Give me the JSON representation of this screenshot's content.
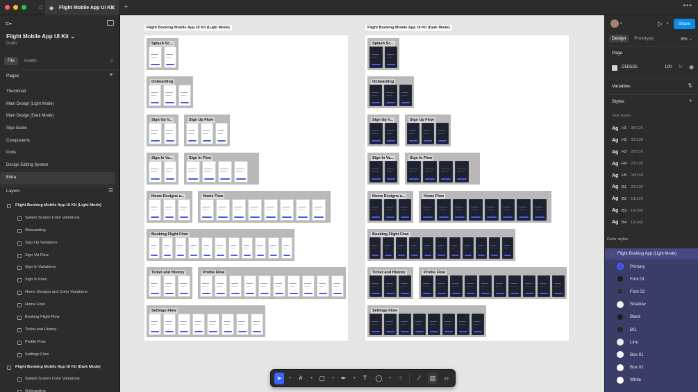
{
  "titlebar": {
    "traffic_colors": [
      "#ff5f57",
      "#febc2e",
      "#28c840"
    ],
    "tab_title": "Flight Mobile App UI Kit",
    "tab_close": "✕",
    "tab_plus": "+",
    "menu": "•••"
  },
  "left_panel": {
    "file_title": "Flight Mobile App UI Kit",
    "file_sub": "Drafts",
    "tabs": [
      "File",
      "Assets"
    ],
    "pages_header": "Pages",
    "pages": [
      "Thumbnail",
      "Main Design (Light Mode)",
      "Main Design (Dark Mode)",
      "Stye Guide",
      "Components",
      "Icons",
      "Design Editing System",
      "Extra"
    ],
    "selected_page_index": 7,
    "layers_header": "Layers",
    "layers": [
      {
        "name": "Flight Booking Mobile App UI Kit (Light Mode)",
        "level": 0
      },
      {
        "name": "Splash Screen Color Variations",
        "level": 1
      },
      {
        "name": "Onboarding",
        "level": 1
      },
      {
        "name": "Sign Up Variations",
        "level": 1
      },
      {
        "name": "Sign Up Flow",
        "level": 1
      },
      {
        "name": "Sign In Variations",
        "level": 1
      },
      {
        "name": "Sign In Flow",
        "level": 1
      },
      {
        "name": "Home Designs and Color Variations",
        "level": 1
      },
      {
        "name": "Home Flow",
        "level": 1
      },
      {
        "name": "Booking Flight Flow",
        "level": 1
      },
      {
        "name": "Ticket and History",
        "level": 1
      },
      {
        "name": "Profile Flow",
        "level": 1
      },
      {
        "name": "Settings Flow",
        "level": 1
      },
      {
        "name": "Flight Booking Mobile App UI Kit (Dark Mode)",
        "level": 0
      },
      {
        "name": "Splash Screen Color Variations",
        "level": 1
      },
      {
        "name": "Onboarding",
        "level": 1
      }
    ]
  },
  "canvas": {
    "frames": [
      {
        "label": "Flight Booking Mobile App UI Kit (Light Mode)",
        "mode": "light",
        "groups": [
          {
            "title": "Splash Sc...",
            "screens": 2
          },
          {
            "title": "Onboarding",
            "screens": 3
          },
          {
            "title": "Sign Up V...",
            "screens": 2
          },
          {
            "title": "Sign Up Flow",
            "screens": 3
          },
          {
            "title": "Sign In Va...",
            "screens": 2
          },
          {
            "title": "Sign In Flow",
            "screens": 4
          },
          {
            "title": "Home Designs a...",
            "screens": 3
          },
          {
            "title": "Home Flow",
            "screens": 8
          },
          {
            "title": "Booking Flight Flow",
            "screens": 11
          },
          {
            "title": "Ticket and History",
            "screens": 3
          },
          {
            "title": "Profile Flow",
            "screens": 10
          },
          {
            "title": "Settings Flow",
            "screens": 8
          }
        ]
      },
      {
        "label": "Flight Booking Mobile App UI Kit (Dark Mode)",
        "mode": "dark",
        "groups": [
          {
            "title": "Splash Sc...",
            "screens": 2
          },
          {
            "title": "Onboarding",
            "screens": 3
          },
          {
            "title": "Sign Up V...",
            "screens": 2
          },
          {
            "title": "Sign Up Flow",
            "screens": 3
          },
          {
            "title": "Sign In Va...",
            "screens": 2
          },
          {
            "title": "Sign In Flow",
            "screens": 4
          },
          {
            "title": "Home Designs a...",
            "screens": 3
          },
          {
            "title": "Home Flow",
            "screens": 8
          },
          {
            "title": "Booking Flight Flow",
            "screens": 11
          },
          {
            "title": "Ticket and History",
            "screens": 3
          },
          {
            "title": "Profile Flow",
            "screens": 10
          },
          {
            "title": "Settings Flow",
            "screens": 8
          }
        ]
      }
    ]
  },
  "toolbar": {
    "tools": [
      "move-tool",
      "frame-tool",
      "shape-tool",
      "pen-tool",
      "text-tool",
      "comment-tool",
      "actions-tool",
      "dev-mode-tool",
      "code-tool"
    ]
  },
  "right_panel": {
    "share_label": "Share",
    "tabs": [
      "Design",
      "Prototype"
    ],
    "zoom": "8%",
    "page_header": "Page",
    "page_color_hex": "D5D5D5",
    "page_color_opacity": "100",
    "page_color_unit": "%",
    "page_color": "#d5d5d5",
    "variables_header": "Variables",
    "styles_header": "Styles",
    "text_styles_header": "Text styles",
    "text_styles": [
      {
        "name": "H1",
        "value": "38/120"
      },
      {
        "name": "H2",
        "value": "32/130"
      },
      {
        "name": "H3",
        "value": "28/120"
      },
      {
        "name": "H4",
        "value": "22/120"
      },
      {
        "name": "H5",
        "value": "18/150"
      },
      {
        "name": "B1",
        "value": "20/130"
      },
      {
        "name": "B2",
        "value": "18/120"
      },
      {
        "name": "B3",
        "value": "16/160"
      },
      {
        "name": "B4",
        "value": "12/140"
      }
    ],
    "ag_label": "Ag",
    "color_styles_header": "Color styles",
    "color_group_name": "Flight Booking App (Light Mode)",
    "colors": [
      {
        "name": "Primary",
        "hex": "#3b4ee8"
      },
      {
        "name": "Font 01",
        "hex": "#1a1d2b"
      },
      {
        "name": "Font 02",
        "hex": "#2a2d3b"
      },
      {
        "name": "Shadow",
        "hex": "#f4f4f6"
      },
      {
        "name": "Black",
        "hex": "#1b1e2c"
      },
      {
        "name": "BG",
        "hex": "#20222e"
      },
      {
        "name": "Line",
        "hex": "#ececf0"
      },
      {
        "name": "Box 01",
        "hex": "#f7f7f9"
      },
      {
        "name": "Box 02",
        "hex": "#ffffff"
      },
      {
        "name": "White",
        "hex": "#ffffff"
      }
    ]
  }
}
